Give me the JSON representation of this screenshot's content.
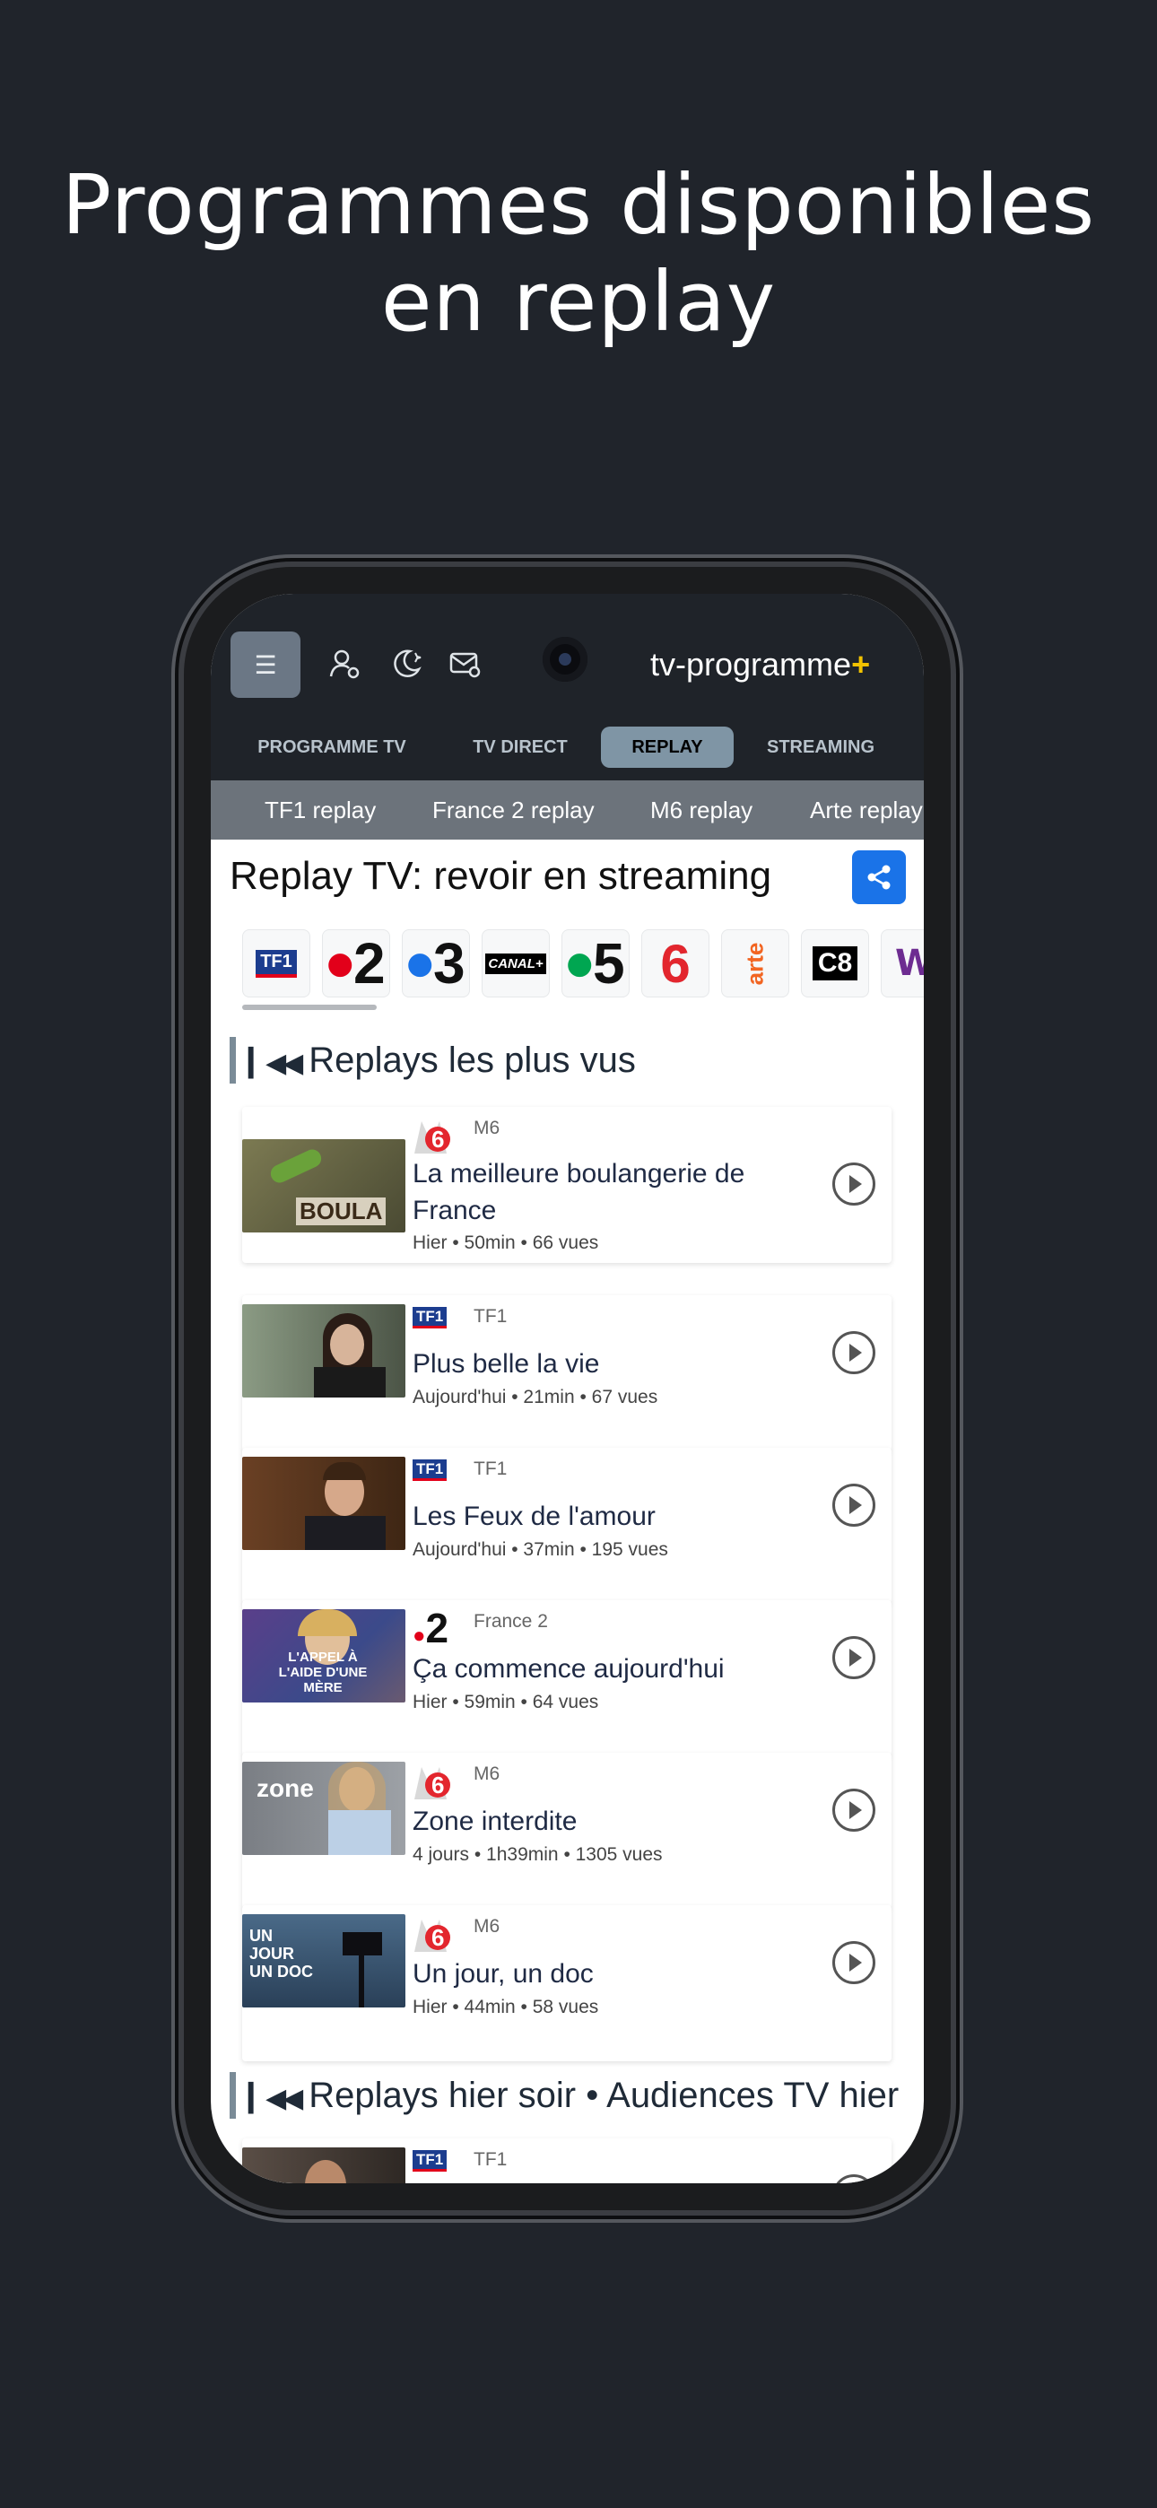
{
  "headline": {
    "line1": "Programmes disponibles",
    "line2": "en replay"
  },
  "app": {
    "brand": "tv-programme",
    "brand_plus": "+"
  },
  "nav": [
    "PROGRAMME TV",
    "TV DIRECT",
    "REPLAY",
    "STREAMING"
  ],
  "subnav": [
    "TF1 replay",
    "France 2 replay",
    "M6 replay",
    "Arte replay"
  ],
  "page_title": "Replay TV: revoir en streaming",
  "channels": [
    "TF1",
    "2",
    "3",
    "CANAL+",
    "5",
    "6",
    "arte",
    "C8"
  ],
  "sections": {
    "most_viewed": "Replays les plus vus",
    "last_night": "Replays hier soir • Audiences TV hier"
  },
  "cards": [
    {
      "channel": "M6",
      "title": "La meilleure boulangerie de France",
      "info": "Hier • 50min • 66 vues",
      "thumb_text": "BOULA",
      "thumb_color": "#6f6a4d"
    },
    {
      "channel": "TF1",
      "title": "Plus belle la vie",
      "info": "Aujourd'hui • 21min • 67 vues",
      "thumb_text": "",
      "thumb_color": "#6b7a6a"
    },
    {
      "channel": "TF1",
      "title": "Les Feux de l'amour",
      "info": "Aujourd'hui • 37min • 195 vues",
      "thumb_text": "",
      "thumb_color": "#5a3a22"
    },
    {
      "channel": "France 2",
      "title": "Ça commence aujourd'hui",
      "info": "Hier • 59min • 64 vues",
      "thumb_text": "L'APPEL À L'AIDE D'UNE MÈRE",
      "thumb_color": "#3b4a8a"
    },
    {
      "channel": "M6",
      "title": "Zone interdite",
      "info": "4 jours • 1h39min • 1305 vues",
      "thumb_text": "zone",
      "thumb_color": "#8a8e94"
    },
    {
      "channel": "M6",
      "title": "Un jour, un doc",
      "info": "Hier • 44min • 58 vues",
      "thumb_text": "UN JOUR UN DOC",
      "thumb_color": "#3a5670"
    },
    {
      "channel": "TF1",
      "title": "",
      "info": "",
      "thumb_text": "",
      "thumb_color": "#5a4e46"
    }
  ],
  "colors": {
    "accent": "#1a73e8",
    "m6": "#e3262e",
    "tf1_blue": "#1c3d8f",
    "f2_red": "#e2001a"
  }
}
